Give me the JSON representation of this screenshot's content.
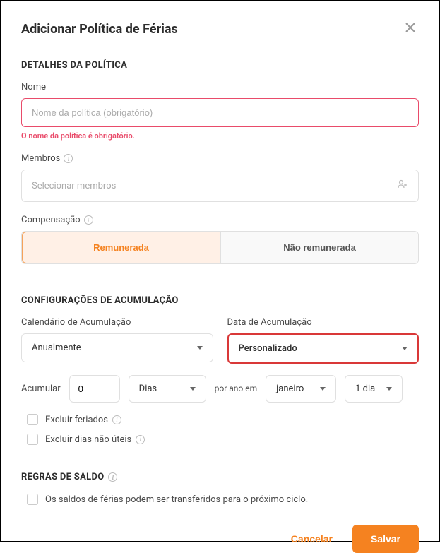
{
  "modal": {
    "title": "Adicionar Política de Férias"
  },
  "sections": {
    "policy_details": "DETALHES DA POLÍTICA",
    "accrual_settings": "CONFIGURAÇÕES DE ACUMULAÇÃO",
    "balance_rules": "REGRAS DE SALDO"
  },
  "fields": {
    "name": {
      "label": "Nome",
      "placeholder": "Nome da política (obrigatório)",
      "error": "O nome da política é obrigatório."
    },
    "members": {
      "label": "Membros",
      "placeholder": "Selecionar membros"
    },
    "compensation": {
      "label": "Compensação",
      "paid": "Remunerada",
      "unpaid": "Não remunerada"
    },
    "accrual_calendar": {
      "label": "Calendário de Acumulação",
      "value": "Anualmente"
    },
    "accrual_date": {
      "label": "Data de Acumulação",
      "value": "Personalizado"
    },
    "accumulate": {
      "label": "Acumular",
      "value": "0",
      "unit": "Dias",
      "per_year": "por ano em",
      "month": "janeiro",
      "day": "1 dia"
    },
    "exclude_holidays": "Excluir feriados",
    "exclude_nonwork": "Excluir dias não úteis",
    "carry_over": "Os saldos de férias podem ser transferidos para o próximo ciclo."
  },
  "buttons": {
    "cancel": "Cancelar",
    "save": "Salvar"
  }
}
